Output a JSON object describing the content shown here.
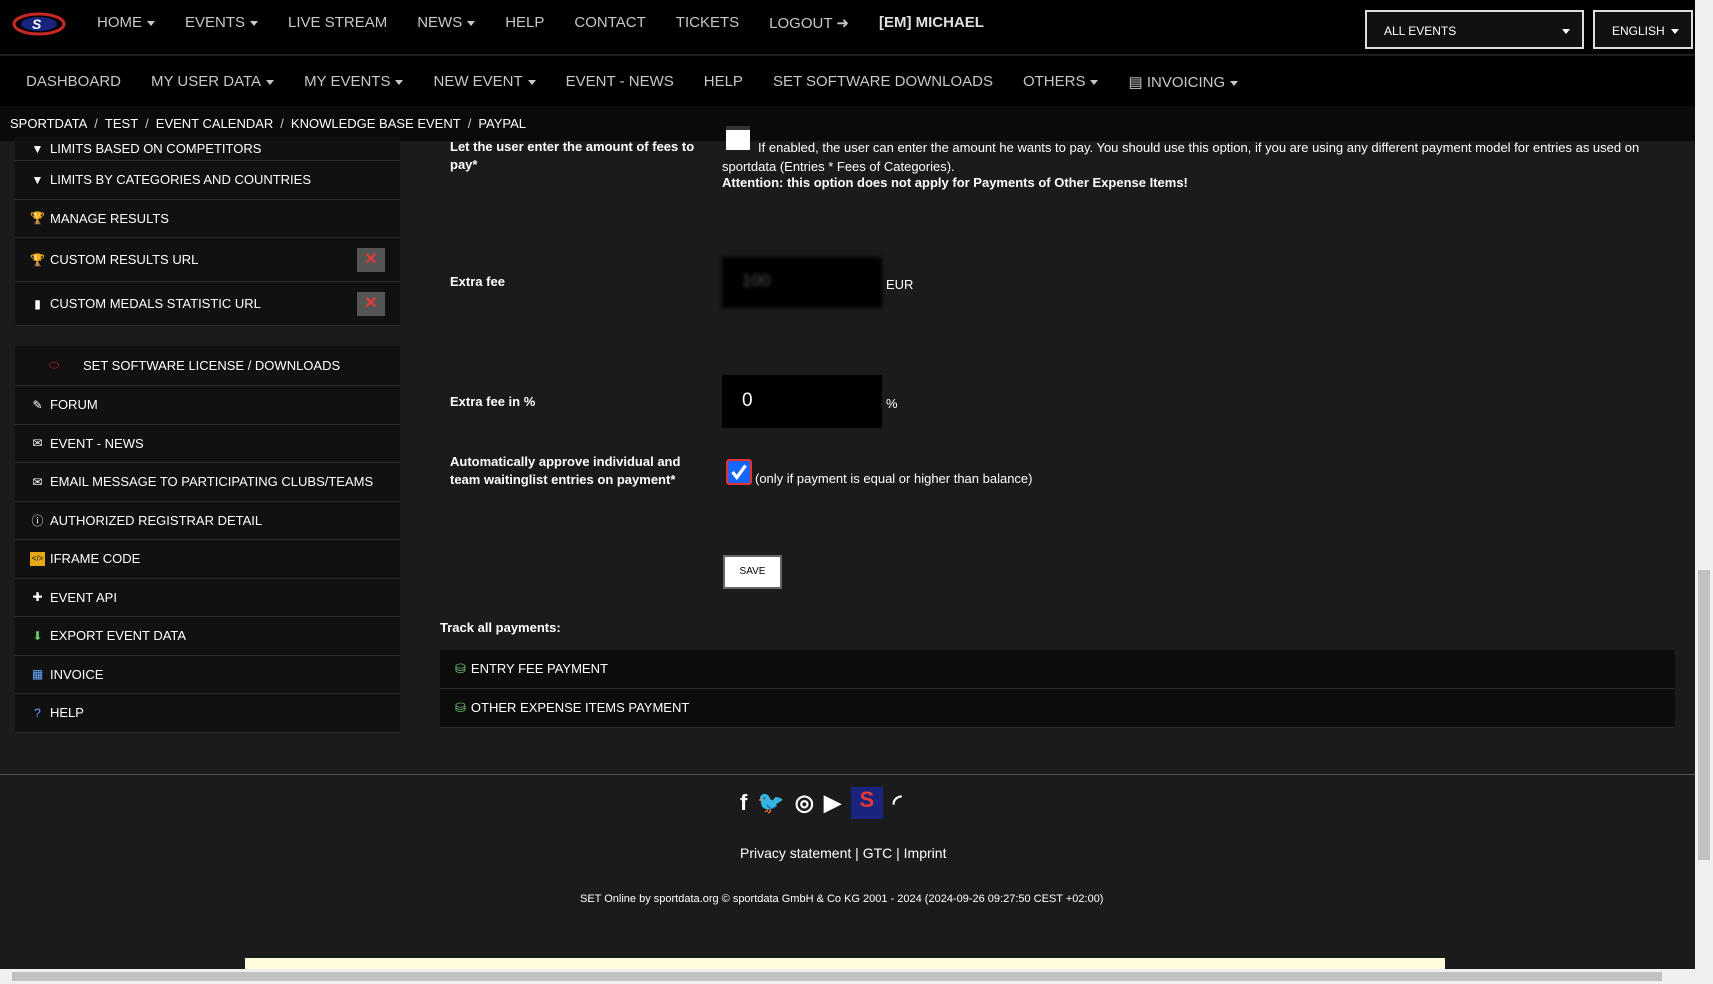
{
  "topnav": {
    "items": [
      {
        "label": "HOME",
        "caret": true
      },
      {
        "label": "EVENTS",
        "caret": true
      },
      {
        "label": "LIVE STREAM",
        "caret": false
      },
      {
        "label": "NEWS",
        "caret": true
      },
      {
        "label": "HELP",
        "caret": false
      },
      {
        "label": "CONTACT",
        "caret": false
      },
      {
        "label": "TICKETS",
        "caret": false
      },
      {
        "label": "LOGOUT",
        "caret": false
      }
    ],
    "user": "[EM] MICHAEL",
    "events_select": "ALL EVENTS",
    "language_select": "ENGLISH"
  },
  "subnav": {
    "items": [
      "DASHBOARD",
      "MY USER DATA",
      "MY EVENTS",
      "NEW EVENT",
      "EVENT - NEWS",
      "HELP",
      "SET SOFTWARE DOWNLOADS",
      "OTHERS",
      "INVOICING"
    ]
  },
  "breadcrumb": [
    "SPORTDATA",
    "TEST",
    "EVENT CALENDAR",
    "KNOWLEDGE BASE EVENT",
    "PAYPAL"
  ],
  "sidebar": {
    "group1": [
      {
        "label": "LIMITS BASED ON COMPETITORS",
        "icon": "filter-icon"
      },
      {
        "label": "LIMITS BY CATEGORIES AND COUNTRIES",
        "icon": "filter-icon"
      },
      {
        "label": "MANAGE RESULTS",
        "icon": "trophy-icon"
      },
      {
        "label": "CUSTOM RESULTS URL",
        "icon": "trophy-icon"
      },
      {
        "label": "CUSTOM MEDALS STATISTIC URL",
        "icon": "bar-chart-icon"
      }
    ],
    "group2": [
      {
        "label": "SET SOFTWARE LICENSE / DOWNLOADS",
        "icon": "set-logo-icon"
      },
      {
        "label": "FORUM",
        "icon": "forum-icon"
      },
      {
        "label": "EVENT - NEWS",
        "icon": "news-icon"
      },
      {
        "label": "EMAIL MESSAGE TO PARTICIPATING CLUBS/TEAMS",
        "icon": "envelope-icon"
      },
      {
        "label": "AUTHORIZED REGISTRAR DETAIL",
        "icon": "info-icon"
      },
      {
        "label": "IFRAME CODE",
        "icon": "code-icon"
      },
      {
        "label": "EVENT API",
        "icon": "puzzle-icon"
      },
      {
        "label": "EXPORT EVENT DATA",
        "icon": "export-icon"
      },
      {
        "label": "INVOICE",
        "icon": "invoice-icon"
      },
      {
        "label": "HELP",
        "icon": "help-icon"
      }
    ]
  },
  "form": {
    "user_fees_label": "Let the user enter the amount of fees to pay*",
    "user_fees_desc": "If enabled, the user can enter the amount he wants to pay. You should use this option, if you are using any different payment model for entries as used on sportdata (Entries * Fees of Categories).",
    "user_fees_attention": "Attention: this option does not apply for Payments of Other Expense Items!",
    "extra_fee_label": "Extra fee",
    "extra_fee_value": "100",
    "extra_fee_unit": "EUR",
    "extra_fee_pct_label": "Extra fee in %",
    "extra_fee_pct_value": "0",
    "extra_fee_pct_unit": "%",
    "auto_approve_label": "Automatically approve individual and team waitinglist entries on payment*",
    "auto_approve_note": "(only if payment is equal or higher than balance)",
    "auto_approve_checked": true,
    "save_label": "SAVE"
  },
  "track": {
    "title": "Track all payments:",
    "items": [
      "ENTRY FEE PAYMENT",
      "OTHER EXPENSE ITEMS PAYMENT"
    ]
  },
  "footer": {
    "links": [
      "Privacy statement",
      "GTC",
      "Imprint"
    ],
    "copyright": "SET Online by sportdata.org © sportdata GmbH & Co KG 2001 - 2024 (2024-09-26 09:27:50 CEST +02:00)"
  }
}
